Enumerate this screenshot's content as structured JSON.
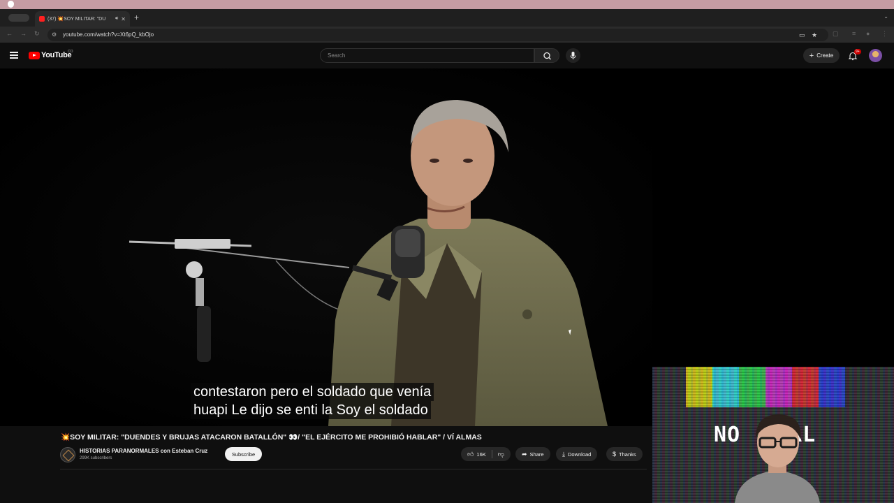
{
  "browser": {
    "tab_title": "(37) 💥SOY MILITAR: \"DU",
    "url": "youtube.com/watch?v=Xt6pQ_kbOjo"
  },
  "header": {
    "logo_text": "YouTube",
    "logo_super": "CO",
    "search_placeholder": "Search",
    "create_label": "Create",
    "notif_badge": "9+"
  },
  "video": {
    "caption_lines": [
      "contestaron pero el soldado que venía",
      "huapi Le dijo se enti la Soy el soldado"
    ],
    "title_emoji": "💥",
    "title": "SOY MILITAR: \"DUENDES Y BRUJAS ATACARON BATALLÓN\" 👀/ \"EL EJÉRCITO ME PROHIBIÓ HABLAR\" / VÍ ALMAS"
  },
  "channel": {
    "name": "HISTORIAS PARANORMALES con Esteban Cruz",
    "subscribers": "299K subscribers",
    "subscribe_label": "Subscribe"
  },
  "actions": {
    "likes": "16K",
    "share": "Share",
    "download": "Download",
    "thanks": "Thanks"
  },
  "webcam": {
    "overlay_text_left": "NO",
    "overlay_text_right": "AL",
    "bar_colors": [
      "#d8d800",
      "#28d8e0",
      "#20d040",
      "#d020c8",
      "#e02020",
      "#2030d8"
    ]
  }
}
